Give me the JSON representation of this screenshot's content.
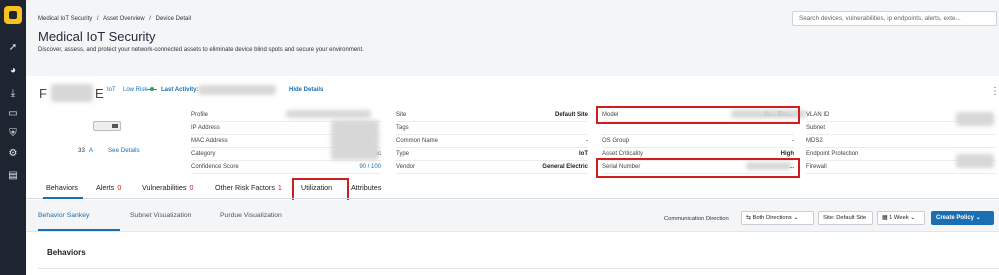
{
  "sidebar": {
    "icons": [
      "logo",
      "activity-icon",
      "dashboard-icon",
      "download-icon",
      "monitor-icon",
      "shield-icon",
      "settings-icon",
      "document-icon"
    ]
  },
  "breadcrumb": [
    "Medical IoT Security",
    "/",
    "Asset Overview",
    "/",
    "Device Detail"
  ],
  "page": {
    "title": "Medical IoT Security",
    "description": "Discover, assess, and protect your network-connected assets to eliminate device blind spots and secure your environment."
  },
  "search": {
    "placeholder": "Search devices, vulnerabilities, ip endpoints, alerts, exte..."
  },
  "device": {
    "name_initial": "F",
    "name_suffix": "E",
    "type_tag": "IoT",
    "risk_tag": "Low Risk",
    "last_activity_label": "Last Activity:",
    "hide_details": "Hide Details",
    "score": "33",
    "score_grade": "A",
    "see_details": "See Details"
  },
  "properties": {
    "col1": [
      {
        "label": "Profile",
        "value": ""
      },
      {
        "label": "IP Address",
        "value": ""
      },
      {
        "label": "MAC Address",
        "value": ""
      },
      {
        "label": "Category",
        "value": "Noc"
      },
      {
        "label": "Confidence Score",
        "value": "90 / 100"
      }
    ],
    "col2": [
      {
        "label": "Site",
        "value": "Default Site"
      },
      {
        "label": "Tags",
        "value": ""
      },
      {
        "label": "Common Name",
        "value": "-"
      },
      {
        "label": "Type",
        "value": "IoT"
      },
      {
        "label": "Vendor",
        "value": "General Electric"
      }
    ],
    "col3": [
      {
        "label": "Model",
        "value": "Se... Ens..."
      },
      {
        "label": "",
        "value": ""
      },
      {
        "label": "OS Group",
        "value": "-"
      },
      {
        "label": "Asset Criticality",
        "value": "High"
      },
      {
        "label": "Serial Number",
        "value": "..."
      }
    ],
    "col4": [
      {
        "label": "VLAN ID",
        "value": ""
      },
      {
        "label": "Subnet",
        "value": ""
      },
      {
        "label": "MDS2",
        "value": ""
      },
      {
        "label": "Endpoint Protection",
        "value": ""
      },
      {
        "label": "Firewall",
        "value": ""
      }
    ]
  },
  "tabs": [
    {
      "label": "Behaviors",
      "count": ""
    },
    {
      "label": "Alerts",
      "count": "0"
    },
    {
      "label": "Vulnerabilities",
      "count": "0"
    },
    {
      "label": "Other Risk Factors",
      "count": "1"
    },
    {
      "label": "Utilization",
      "count": ""
    },
    {
      "label": "Attributes",
      "count": ""
    }
  ],
  "subtabs": [
    "Behavior Sankey",
    "Subnet Visualization",
    "Purdue Visualization"
  ],
  "controls": {
    "direction_label": "Communication Direction",
    "direction_value": "Both Directions",
    "site_value": "Site: Default Site",
    "period_value": "1 Week",
    "create_policy": "Create Policy"
  },
  "section": {
    "title": "Behaviors"
  },
  "colors": {
    "accent": "#1a6fb3",
    "highlight": "#d01e1e",
    "sidebar": "#1e2530",
    "logo": "#f6c21b"
  }
}
